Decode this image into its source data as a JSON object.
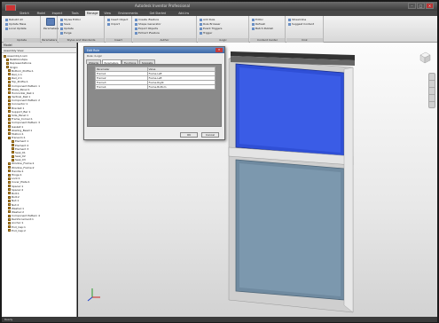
{
  "window": {
    "title": "Autodesk Inventor Professional",
    "controls": [
      "–",
      "□",
      "✕"
    ]
  },
  "tabs": [
    "Sketch",
    "Model",
    "Inspect",
    "Tools",
    "Manage",
    "View",
    "Environments",
    "Get Started",
    "Add-Ins"
  ],
  "active_tab": "Manage",
  "ribbon": {
    "groups": [
      {
        "label": "Update",
        "items": [
          "Rebuild All",
          "Update Mass",
          "Local Update"
        ]
      },
      {
        "label": "Parameters",
        "items": [
          "Parameters"
        ]
      },
      {
        "label": "Styles and Standards",
        "items": [
          "Styles Editor",
          "Save",
          "Update",
          "Purge"
        ]
      },
      {
        "label": "Insert",
        "items": [
          "Insert Object",
          "Import"
        ]
      },
      {
        "label": "Author",
        "items": [
          "Create iFeature",
          "Shape Generator",
          "Export Objects",
          "Extract iFeature"
        ]
      },
      {
        "label": "iLogic",
        "items": [
          "Add Rule",
          "Rule Browser",
          "Event Triggers",
          "Trigger"
        ]
      },
      {
        "label": "Content Center",
        "items": [
          "Editor",
          "Refresh",
          "Batch Publish"
        ]
      },
      {
        "label": "Ilink",
        "items": [
          "Streamline",
          "Suggest Content"
        ]
      }
    ]
  },
  "browser": {
    "title": "Model",
    "dropdown": "Assembly View",
    "items": [
      "Assembly1.iam",
      "Relationships",
      "Representations",
      "Origin",
      "Bottom_Profile:1",
      "Rail_1:1",
      "Rail_2:1",
      "Top_Profile:1",
      "Component Pattern 1",
      "Glass_Panel:1",
      "Horizontal_Rail:1",
      "Vertical_Rail:1",
      "Component Pattern 2",
      "Connector:1",
      "Bracket:1",
      "Support_Bar:1",
      "Side_Panel:1",
      "Frame_Corner:1",
      "Component Pattern 3",
      "Gasket:1",
      "Glazing_Bead:1",
      "Mullion:1",
      "Transom:1",
      "Element 1",
      "Element 2",
      "Element 3",
      "Seal_01",
      "Seal_02",
      "Seal_03",
      "Window_Frame:1",
      "Window_Frame:2",
      "Handle:1",
      "Hinge:1",
      "Lock:1",
      "Cover_Plate:1",
      "Spacer:1",
      "Spacer:2",
      "Bolt:1",
      "Bolt:2",
      "Nut:1",
      "Nut:2",
      "Washer:1",
      "Washer:2",
      "Component Pattern 4",
      "Reinforcement:1",
      "Anchor:1",
      "End_Cap:1",
      "End_Cap:2"
    ]
  },
  "dialog": {
    "title": "Edit Rule",
    "subtitle": "Rule: iLogic",
    "tabs": [
      "Wizards",
      "Parameters",
      "Functions",
      "Snippets"
    ],
    "active_tab": "Parameters",
    "columns": [
      "Parameter",
      "Value"
    ],
    "rows": [
      [
        "Frame1",
        "Frame.Left"
      ],
      [
        "Frame2",
        "Frame.Left"
      ],
      [
        "Frame3",
        "Frame.Right"
      ],
      [
        "Frame4",
        "Frame.Bottom"
      ]
    ],
    "ok_label": "OK",
    "cancel_label": "Cancel"
  },
  "status": "Ready",
  "colors": {
    "glass_top": "#2f4fd6",
    "glass_bottom": "#6f8aa0",
    "frame": "#c8c8c8"
  }
}
